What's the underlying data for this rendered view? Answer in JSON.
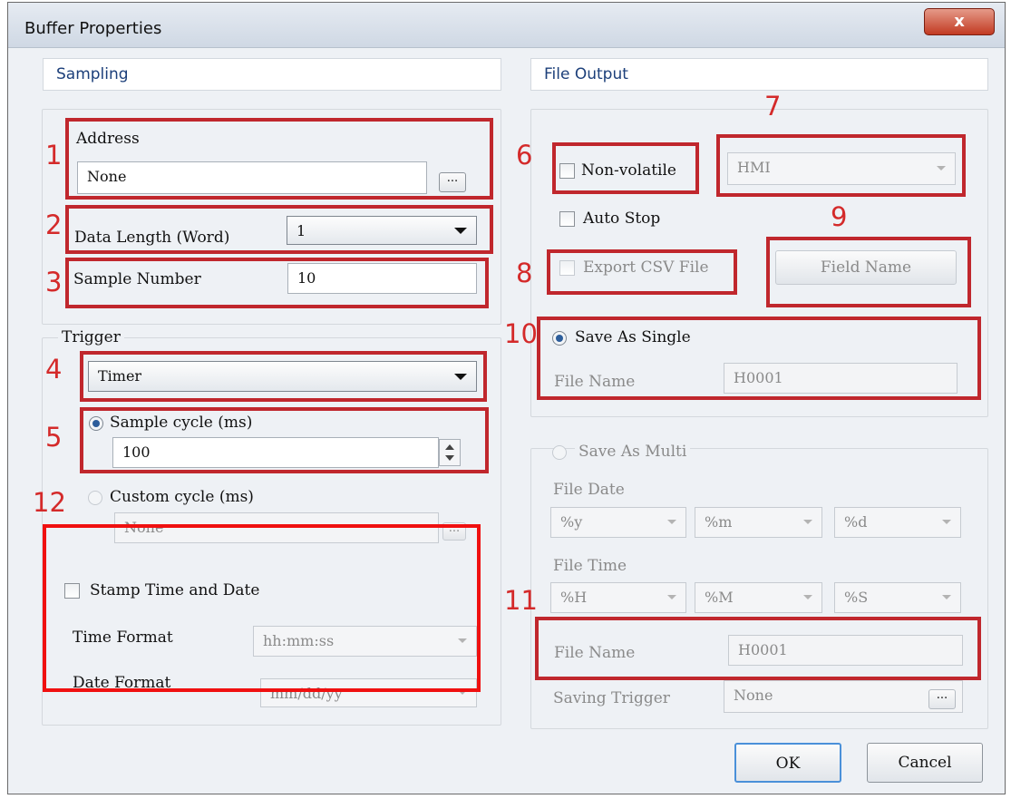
{
  "window": {
    "title": "Buffer Properties",
    "close_glyph": "x"
  },
  "sampling": {
    "header": "Sampling",
    "address": {
      "label": "Address",
      "value": "None",
      "browse": "..."
    },
    "data_length": {
      "label": "Data Length (Word)",
      "value": "1"
    },
    "sample_number": {
      "label": "Sample Number",
      "value": "10"
    },
    "trigger": {
      "label": "Trigger",
      "value": "Timer"
    },
    "sample_cycle": {
      "label": "Sample cycle (ms)",
      "value": "100",
      "selected": true
    },
    "custom_cycle": {
      "label": "Custom cycle (ms)",
      "value": "None",
      "browse": "..."
    },
    "stamp": {
      "label": "Stamp Time and Date",
      "time_format_label": "Time Format",
      "time_format_value": "hh:mm:ss",
      "date_format_label": "Date Format",
      "date_format_value": "mm/dd/yy"
    }
  },
  "file_output": {
    "header": "File Output",
    "non_volatile": {
      "label": "Non-volatile",
      "checked": false
    },
    "storage": {
      "value": "HMI"
    },
    "auto_stop": {
      "label": "Auto Stop",
      "checked": false
    },
    "export_csv": {
      "label": "Export CSV File",
      "checked": false
    },
    "field_name_button": "Field Name",
    "save_single": {
      "label": "Save As Single",
      "file_name_label": "File Name",
      "file_name_value": "H0001",
      "selected": true
    },
    "save_multi": {
      "label": "Save As Multi",
      "file_date_label": "File Date",
      "date_parts": [
        "%y",
        "%m",
        "%d"
      ],
      "file_time_label": "File Time",
      "time_parts": [
        "%H",
        "%M",
        "%S"
      ],
      "file_name_label": "File Name",
      "file_name_value": "H0001",
      "saving_trigger_label": "Saving Trigger",
      "saving_trigger_value": "None",
      "browse": "..."
    }
  },
  "buttons": {
    "ok": "OK",
    "cancel": "Cancel"
  },
  "annotations": [
    "1",
    "2",
    "3",
    "4",
    "5",
    "6",
    "7",
    "8",
    "9",
    "10",
    "11",
    "12"
  ],
  "colors": {
    "annotation_red": "#c0272d",
    "bright_red": "#f01010",
    "header_text": "#1c3f7a"
  }
}
